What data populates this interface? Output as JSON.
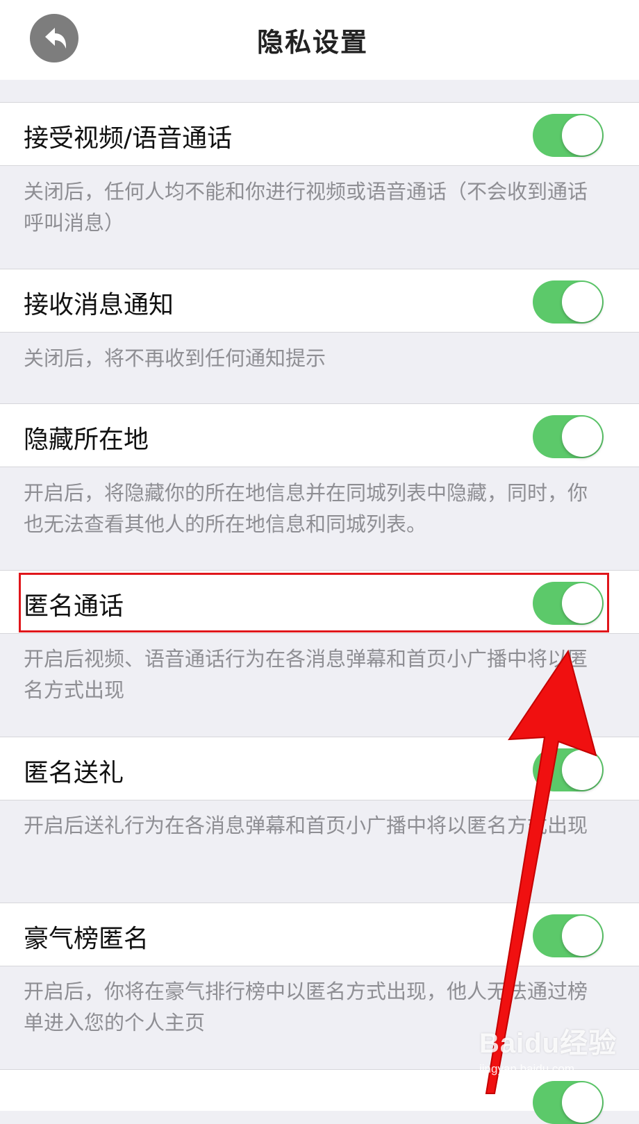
{
  "header": {
    "title": "隐私设置",
    "back_icon": "back-arrow-icon"
  },
  "settings": [
    {
      "label": "接受视频/语音通话",
      "enabled": true,
      "description": "关闭后，任何人均不能和你进行视频或语音通话（不会收到通话呼叫消息）"
    },
    {
      "label": "接收消息通知",
      "enabled": true,
      "description": "关闭后，将不再收到任何通知提示"
    },
    {
      "label": "隐藏所在地",
      "enabled": true,
      "description": "开启后，将隐藏你的所在地信息并在同城列表中隐藏，同时，你也无法查看其他人的所在地信息和同城列表。"
    },
    {
      "label": "匿名通话",
      "enabled": true,
      "description": "开启后视频、语音通话行为在各消息弹幕和首页小广播中将以匿名方式出现"
    },
    {
      "label": "匿名送礼",
      "enabled": true,
      "description": "开启后送礼行为在各消息弹幕和首页小广播中将以匿名方式出现"
    },
    {
      "label": "豪气榜匿名",
      "enabled": true,
      "description": "开启后，你将在豪气排行榜中以匿名方式出现，他人无法通过榜单进入您的个人主页"
    }
  ],
  "colors": {
    "toggle_on": "#5cc96a",
    "annotation": "#e0161b"
  },
  "watermark": {
    "logo": "Baidu经验",
    "url": "jingyan.baidu.com"
  }
}
